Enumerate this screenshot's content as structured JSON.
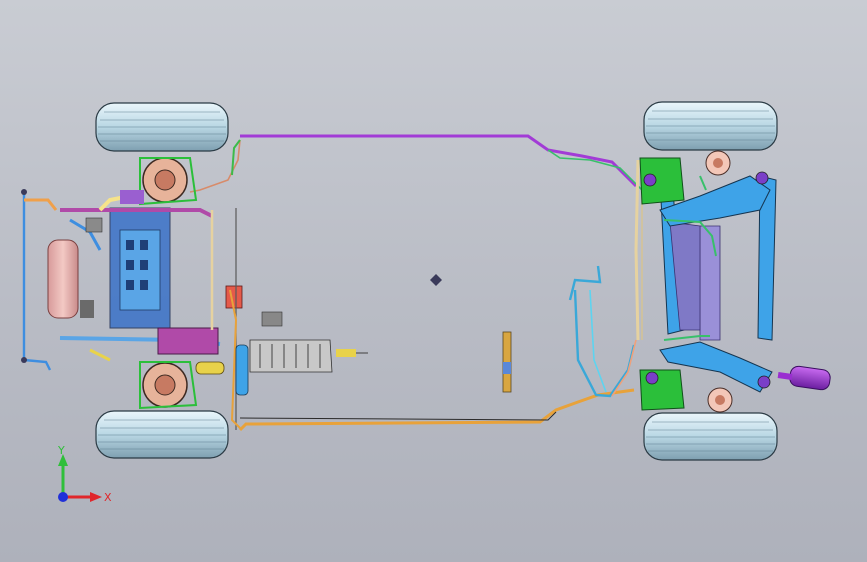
{
  "viewport": {
    "background_top": "#c9ccd3",
    "background_bottom": "#aeb1bb"
  },
  "triad": {
    "x_label": "X",
    "y_label": "Y",
    "x_color": "#e0262b",
    "y_color": "#2fbf3a",
    "z_color": "#2030d8"
  },
  "model": {
    "tire_color": "#cfe6f0",
    "brake_line_purple": "#a23bd6",
    "fuel_line_orange": "#e8a23a",
    "rear_subframe_color": "#3ea3e8",
    "front_subframe_color": "#3a72c8",
    "steering_rack_color": "#b04aa8",
    "rear_knuckle_green": "#2bbf3a",
    "muffler_color": "#9a2fd0"
  }
}
